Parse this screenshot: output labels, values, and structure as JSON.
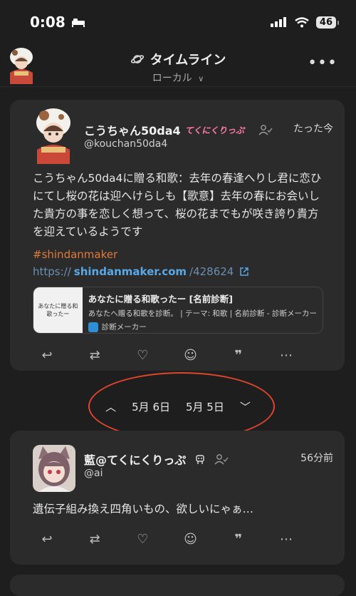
{
  "status": {
    "time": "0:08",
    "battery": "46"
  },
  "header": {
    "title": "タイムライン",
    "subtitle": "ローカル",
    "more": "•••"
  },
  "posts": [
    {
      "display_name": "こうちゃん50da4",
      "name_deco": "てくにくりっぷ",
      "handle": "@kouchan50da4",
      "time": "たった今",
      "text": "こうちゃん50da4に贈る和歌：去年の春逢へりし君に恋ひにてし桜の花は迎へけらしも【歌意】去年の春にお会いした貴方の事を恋しく想って、桜の花までもが咲き誇り貴方を迎えているようです",
      "hashtag": "#shindanmaker",
      "link": {
        "scheme": "https://",
        "domain": "shindanmaker.com",
        "path": "/428624"
      },
      "preview": {
        "thumb_text": "あなたに贈る和歌ったー",
        "title": "あなたに贈る和歌ったー [名前診断]",
        "description": "あなたへ贈る和歌を診断。 | テーマ: 和歌 | 名前診断 - 診断メーカー",
        "site": "診断メーカー"
      }
    },
    {
      "display_name": "藍@てくにくりっぷ",
      "handle": "@ai",
      "time": "56分前",
      "text": "遺伝子組み換え四角いもの、欲しいにゃぁ…"
    }
  ],
  "date_nav": {
    "prev": "5月 6日",
    "next": "5月 5日"
  },
  "icons": [
    "reply-icon",
    "renote-icon",
    "heart-icon",
    "reaction-icon",
    "quote-icon",
    "more-icon"
  ],
  "colors": {
    "background": "#1e1e1e",
    "card": "#2b2b2b",
    "hashtag": "#e07a3a",
    "link": "#5aa8e6",
    "annotation": "#e0452c"
  }
}
